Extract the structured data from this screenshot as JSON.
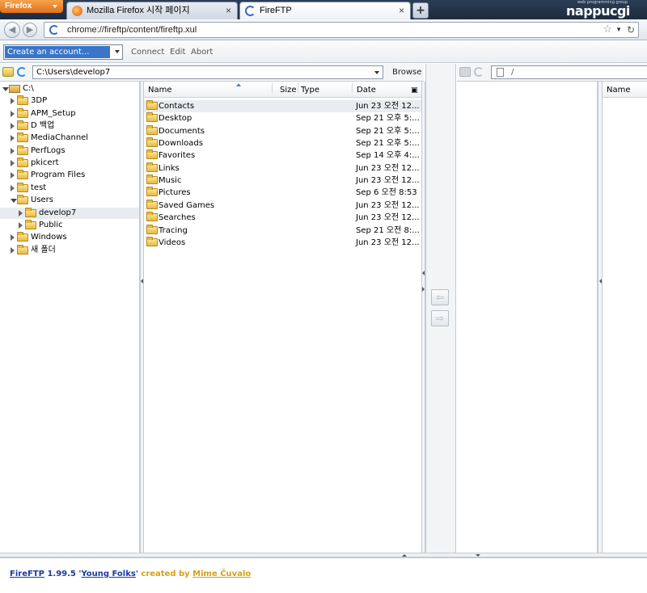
{
  "browser": {
    "menu_button": "Firefox",
    "tabs": [
      {
        "label": "Mozilla Firefox 시작 페이지",
        "active": false
      },
      {
        "label": "FireFTP",
        "active": true
      }
    ],
    "new_tab": "+",
    "brand_logo": "nappucgi",
    "brand_tagline": "web programming group",
    "url": "chrome://fireftp/content/fireftp.xul"
  },
  "toolbar": {
    "account_select": "Create an account...",
    "connect": "Connect",
    "edit": "Edit",
    "abort": "Abort"
  },
  "local": {
    "path": "C:\\Users\\develop7",
    "browse": "Browse",
    "tree": [
      {
        "label": "C:\\",
        "level": 0,
        "open": true,
        "type": "drive"
      },
      {
        "label": "3DP",
        "level": 1
      },
      {
        "label": "APM_Setup",
        "level": 1
      },
      {
        "label": "D 백업",
        "level": 1
      },
      {
        "label": "MediaChannel",
        "level": 1
      },
      {
        "label": "PerfLogs",
        "level": 1
      },
      {
        "label": "pkicert",
        "level": 1
      },
      {
        "label": "Program Files",
        "level": 1
      },
      {
        "label": "test",
        "level": 1
      },
      {
        "label": "Users",
        "level": 1,
        "open": true
      },
      {
        "label": "develop7",
        "level": 2,
        "selected": true
      },
      {
        "label": "Public",
        "level": 2
      },
      {
        "label": "Windows",
        "level": 1
      },
      {
        "label": "새 폴더",
        "level": 1
      }
    ],
    "columns": {
      "name": "Name",
      "size": "Size",
      "type": "Type",
      "date": "Date"
    },
    "files": [
      {
        "name": "Contacts",
        "date": "Jun 23 오전 12..."
      },
      {
        "name": "Desktop",
        "date": "Sep 21 오후 5:..."
      },
      {
        "name": "Documents",
        "date": "Sep 21 오후 5:..."
      },
      {
        "name": "Downloads",
        "date": "Sep 21 오후 5:..."
      },
      {
        "name": "Favorites",
        "date": "Sep 14 오후 4:..."
      },
      {
        "name": "Links",
        "date": "Jun 23 오전 12..."
      },
      {
        "name": "Music",
        "date": "Jun 23 오전 12..."
      },
      {
        "name": "Pictures",
        "date": "Sep 6 오전 8:53"
      },
      {
        "name": "Saved Games",
        "date": "Jun 23 오전 12..."
      },
      {
        "name": "Searches",
        "date": "Jun 23 오전 12..."
      },
      {
        "name": "Tracing",
        "date": "Sep 21 오전 8:..."
      },
      {
        "name": "Videos",
        "date": "Jun 23 오전 12..."
      }
    ]
  },
  "remote": {
    "path": "/",
    "columns": {
      "name": "Name"
    }
  },
  "log": {
    "app_link": "FireFTP",
    "version": "1.99.5",
    "codename": "Young Folks",
    "created_by": "created by",
    "author": "Mime Čuvalo"
  },
  "icons": [
    "firefox-icon",
    "fireftp-icon",
    "back-icon",
    "forward-icon",
    "star-icon",
    "reload-icon",
    "refresh-icon",
    "new-folder-icon",
    "folder-icon",
    "drive-icon",
    "upload-arrow-icon",
    "download-arrow-icon",
    "disconnect-icon",
    "page-icon",
    "column-picker-icon"
  ],
  "colors": {
    "accent": "#3a75c9",
    "tabbar": "#1d2b3f",
    "folder": "#e8b93c",
    "log_link": "#1b3a9e",
    "log_author": "#d6a019"
  }
}
